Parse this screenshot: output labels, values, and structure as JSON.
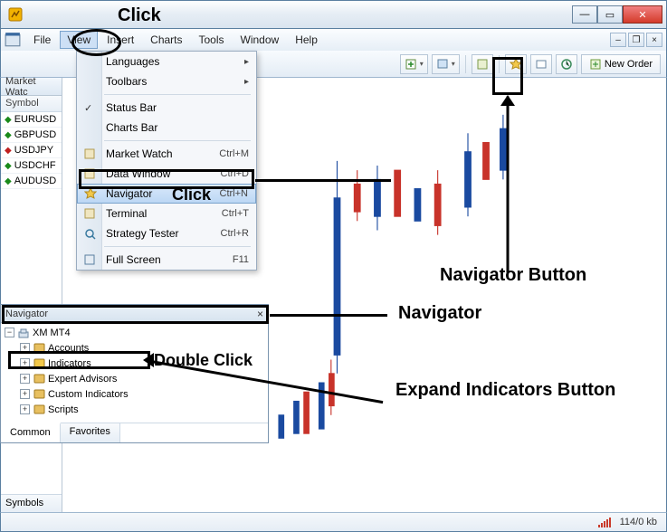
{
  "menubar": {
    "items": [
      "File",
      "View",
      "Insert",
      "Charts",
      "Tools",
      "Window",
      "Help"
    ]
  },
  "toolbar": {
    "new_order_label": "New Order"
  },
  "market_watch": {
    "title": "Market Watc",
    "col_symbol": "Symbol",
    "rows": [
      {
        "sym": "EURUSD",
        "dir": "up"
      },
      {
        "sym": "GBPUSD",
        "dir": "up"
      },
      {
        "sym": "USDJPY",
        "dir": "down"
      },
      {
        "sym": "USDCHF",
        "dir": "up"
      },
      {
        "sym": "AUDUSD",
        "dir": "up"
      }
    ],
    "tab": "Symbols"
  },
  "view_menu": {
    "items": [
      {
        "label": "Languages",
        "sub": true
      },
      {
        "label": "Toolbars",
        "sub": true
      },
      {
        "label": "Status Bar",
        "checked": true
      },
      {
        "label": "Charts Bar"
      },
      {
        "label": "Market Watch",
        "shortcut": "Ctrl+M",
        "icon": "market-watch-icon"
      },
      {
        "label": "Data Window",
        "shortcut": "Ctrl+D",
        "icon": "data-window-icon"
      },
      {
        "label": "Navigator",
        "shortcut": "Ctrl+N",
        "icon": "navigator-icon",
        "selected": true
      },
      {
        "label": "Terminal",
        "shortcut": "Ctrl+T",
        "icon": "terminal-icon"
      },
      {
        "label": "Strategy Tester",
        "shortcut": "Ctrl+R",
        "icon": "strategy-tester-icon"
      },
      {
        "label": "Full Screen",
        "shortcut": "F11",
        "icon": "fullscreen-icon"
      }
    ]
  },
  "navigator": {
    "title": "Navigator",
    "root": "XM MT4",
    "nodes": [
      {
        "label": "Accounts",
        "icon": "accounts-icon"
      },
      {
        "label": "Indicators",
        "icon": "indicators-icon"
      },
      {
        "label": "Expert Advisors",
        "icon": "expert-advisors-icon"
      },
      {
        "label": "Custom Indicators",
        "icon": "custom-indicators-icon"
      },
      {
        "label": "Scripts",
        "icon": "scripts-icon"
      }
    ],
    "tabs": [
      "Common",
      "Favorites"
    ]
  },
  "status": {
    "speed": "114/0 kb"
  },
  "annotations": {
    "click_top": "Click",
    "click_mid": "Click",
    "double_click": "Double Click",
    "navigator_button": "Navigator Button",
    "navigator_label": "Navigator",
    "expand_indicators": "Expand Indicators Button"
  }
}
